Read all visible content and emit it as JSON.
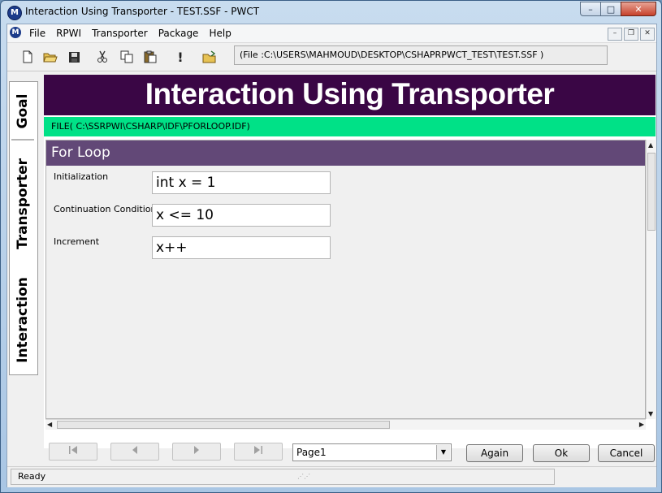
{
  "window": {
    "title": "Interaction Using Transporter - TEST.SSF  - PWCT",
    "app_icon": "M",
    "controls": {
      "minimize": "–",
      "maximize": "□",
      "close": "✕"
    }
  },
  "menu": {
    "items": [
      "File",
      "RPWI",
      "Transporter",
      "Package",
      "Help"
    ],
    "mdi_controls": {
      "minimize": "–",
      "restore": "❐",
      "close": "✕"
    }
  },
  "toolbar": {
    "buttons": [
      "new-file-icon",
      "open-folder-icon",
      "save-icon",
      "cut-icon",
      "copy-icon",
      "paste-icon",
      "exclamation-icon",
      "folder-open-icon"
    ],
    "file_path": "(File :C:\\USERS\\MAHMOUD\\DESKTOP\\CSHAPRPWCT_TEST\\TEST.SSF )"
  },
  "side_tabs": {
    "goal": "Goal",
    "transporter": "Transporter",
    "interaction": "Interaction"
  },
  "banner": {
    "title": "Interaction Using Transporter",
    "color": "#3a0645"
  },
  "file_bar": {
    "text": "FILE( C:\\SSRPWI\\CSHARP\\IDF\\PFORLOOP.IDF)",
    "color": "#00e187"
  },
  "form": {
    "section_title": "For Loop",
    "header_color": "#624877",
    "fields": [
      {
        "label": "Initialization",
        "value": "int x = 1"
      },
      {
        "label": "Continuation Condition",
        "value": "x <= 10"
      },
      {
        "label": "Increment",
        "value": "x++"
      }
    ]
  },
  "navigation": {
    "first_icon": "first-page-icon",
    "prev_icon": "previous-page-icon",
    "next_icon": "next-page-icon",
    "last_icon": "last-page-icon",
    "page_select": "Page1",
    "again": "Again",
    "ok": "Ok",
    "cancel": "Cancel"
  },
  "status": {
    "text": "Ready"
  }
}
